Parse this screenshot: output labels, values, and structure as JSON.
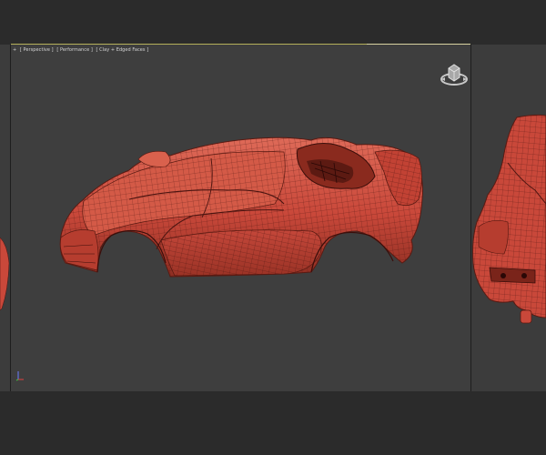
{
  "viewport_main": {
    "label": {
      "menu": "+",
      "view": "[ Perspective ]",
      "mode": "[ Performance ]",
      "shading": "[ Clay + Edged Faces ]"
    },
    "viewcube_icon": "viewcube-home-icon",
    "axis_icon": "axis-tripod-icon"
  },
  "colors": {
    "model": "#c9483a",
    "model_light": "#de6a58",
    "model_dark": "#7a241a",
    "wire": "#4a1410",
    "viewport_bg": "#3e3e3e",
    "ui_bg": "#2b2b2b",
    "active_border": "#b4b05a"
  }
}
